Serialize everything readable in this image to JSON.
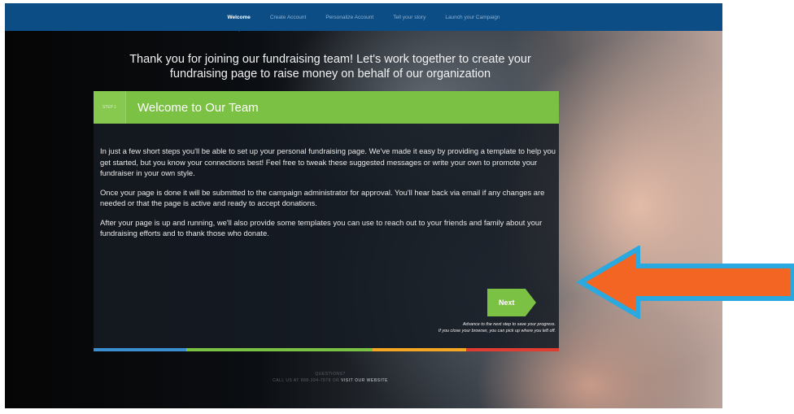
{
  "nav": {
    "items": [
      {
        "label": "Welcome",
        "active": true
      },
      {
        "label": "Create Account",
        "active": false
      },
      {
        "label": "Personalize Account",
        "active": false
      },
      {
        "label": "Tell your story",
        "active": false
      },
      {
        "label": "Launch your Campaign",
        "active": false
      }
    ]
  },
  "headline": {
    "line1": "Thank you for joining our fundraising team! Let's work together to create your",
    "line2": "fundraising page to raise money on behalf of our organization"
  },
  "card": {
    "step_label": "STEP 1",
    "title": "Welcome to Our Team",
    "paragraphs": [
      "In just a few short steps you'll be able to set up your personal fundraising page. We've made it easy by providing a template to help you get started, but you know your connections best! Feel free to tweak these suggested messages or write your own to promote your fundraiser in your own style.",
      "Once your page is done it will be submitted to the campaign administrator for approval. You'll hear back via email if any changes are needed or that the page is active and ready to accept donations.",
      "After your page is up and running, we'll also provide some templates you can use to reach out to your friends and family about your fundraising efforts and to thank those who donate."
    ],
    "next_label": "Next",
    "next_note_line1": "Advance to the next step to save your progress.",
    "next_note_line2": "If you close your browser, you can pick up where you left off."
  },
  "footer": {
    "questions": "QUESTIONS?",
    "call_text": "CALL US AT 888-394-7878 OR",
    "visit_label": "VISIT OUR WEBSITE"
  },
  "colors": {
    "nav_bg": "#0c4d86",
    "accent_green": "#7bc143",
    "arrow_fill": "#f26522",
    "arrow_stroke": "#29a9e0",
    "stripe": [
      "#3b8fd0",
      "#7bc143",
      "#7bc143",
      "#f5a623",
      "#e03c31"
    ]
  }
}
